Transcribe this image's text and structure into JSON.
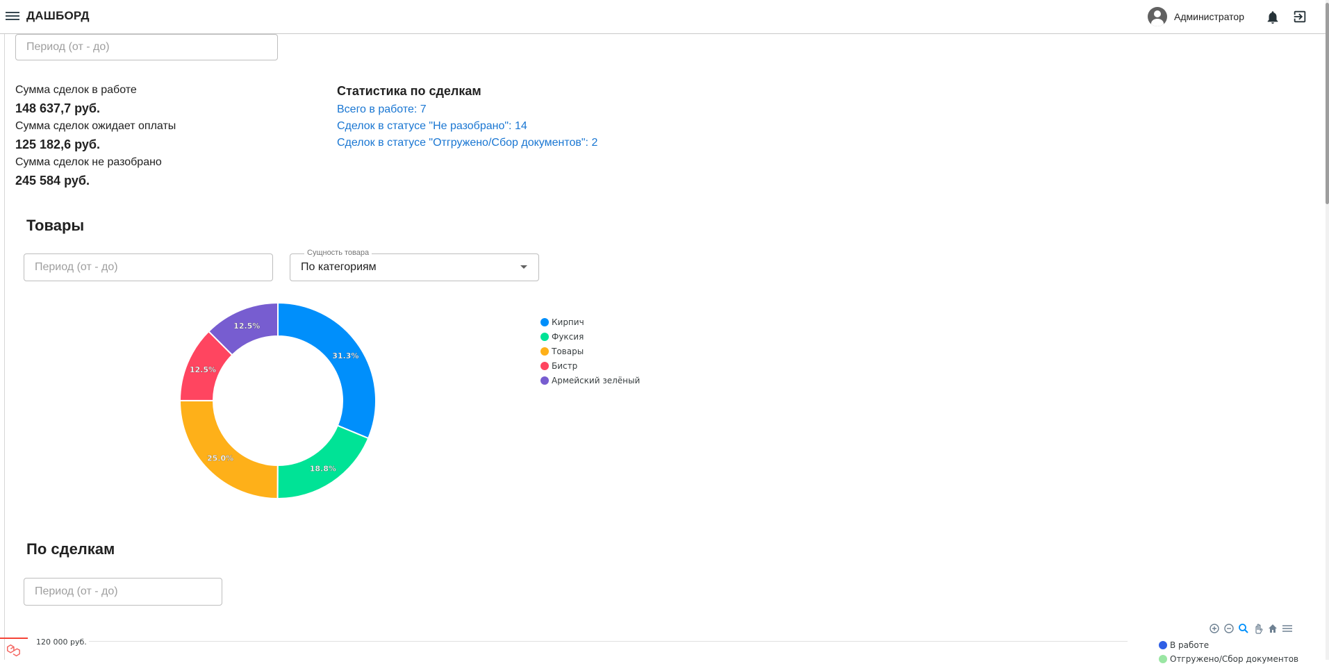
{
  "header": {
    "title": "ДАШБОРД",
    "user_name": "Администратор"
  },
  "deals": {
    "period_placeholder": "Период (от - до)",
    "sums": [
      {
        "label": "Сумма сделок в работе",
        "value": "148 637,7 руб."
      },
      {
        "label": "Сумма сделок ожидает оплаты",
        "value": "125 182,6 руб."
      },
      {
        "label": "Сумма сделок не разобрано",
        "value": "245 584 руб."
      }
    ],
    "stats_title": "Статистика по сделкам",
    "stats_links": [
      "Всего в работе: 7",
      "Сделок в статусе \"Не разобрано\": 14",
      "Сделок в статусе \"Отгружено/Сбор документов\": 2"
    ]
  },
  "products": {
    "title": "Товары",
    "period_placeholder": "Период (от - до)",
    "entity_label": "Сущность товара",
    "entity_value": "По категориям"
  },
  "by_deals": {
    "title": "По сделкам",
    "period_placeholder": "Период (от - до)",
    "y_tick_top": "120 000 руб.",
    "legend": [
      "В работе",
      "Отгружено/Сбор документов"
    ],
    "legend_colors": [
      "#2f5fe5",
      "#9ae6a3"
    ]
  },
  "chart_data": {
    "type": "pie",
    "variant": "donut",
    "categories": [
      "Кирпич",
      "Фуксия",
      "Товары",
      "Бистр",
      "Армейский зелёный"
    ],
    "values": [
      31.3,
      18.8,
      25.0,
      12.5,
      12.5
    ],
    "labels": [
      "31.3%",
      "18.8%",
      "25.0%",
      "12.5%",
      "12.5%"
    ],
    "colors": [
      "#008ffb",
      "#00e396",
      "#feb019",
      "#ff4560",
      "#775dd0"
    ],
    "legend_position": "right"
  }
}
